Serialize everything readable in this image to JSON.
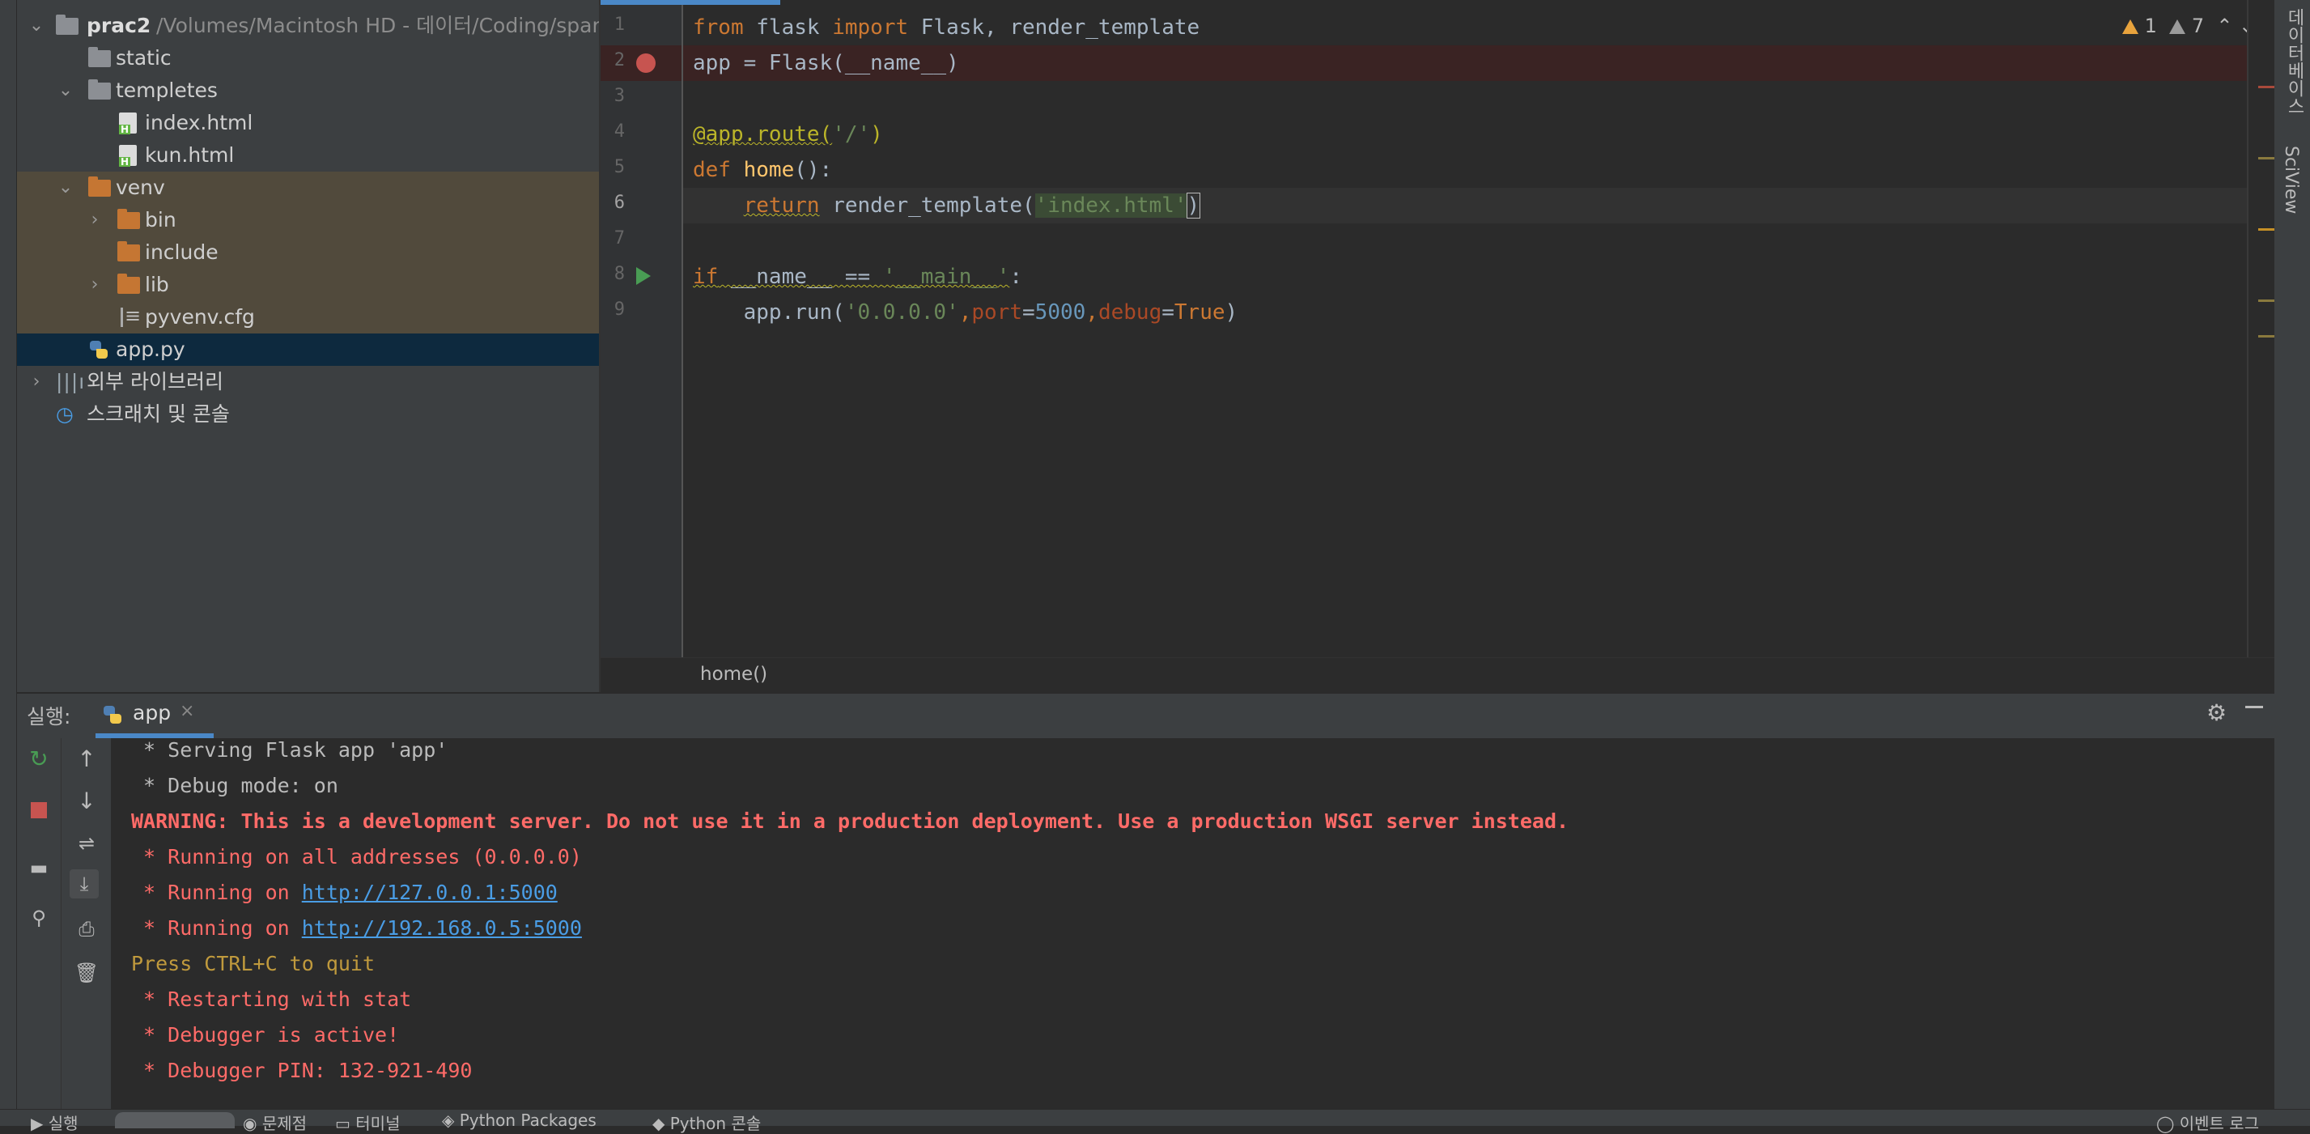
{
  "project": {
    "root": {
      "name": "prac2",
      "path": "/Volumes/Macintosh HD - 데이터/Coding/spar"
    },
    "items": [
      {
        "label": "static"
      },
      {
        "label": "templetes"
      },
      {
        "label": "index.html"
      },
      {
        "label": "kun.html"
      },
      {
        "label": "venv"
      },
      {
        "label": "bin"
      },
      {
        "label": "include"
      },
      {
        "label": "lib"
      },
      {
        "label": "pyvenv.cfg"
      },
      {
        "label": "app.py"
      },
      {
        "label": "외부 라이브러리"
      },
      {
        "label": "스크래치 및 콘솔"
      }
    ]
  },
  "editor": {
    "line_numbers": [
      "1",
      "2",
      "3",
      "4",
      "5",
      "6",
      "7",
      "8",
      "9"
    ],
    "lines": [
      [
        "from",
        " flask ",
        "import",
        " Flask, render_template"
      ],
      [
        "app = Flask(__name__)"
      ],
      [
        ""
      ],
      [
        "@app.route(",
        "'/'",
        ")"
      ],
      [
        "def",
        " ",
        "home",
        "():"
      ],
      [
        "    ",
        "return",
        " render_template(",
        "'index.html'",
        ")"
      ],
      [
        ""
      ],
      [
        "if",
        " __name__ == ",
        "'__main__'",
        ":"
      ],
      [
        "    app.run(",
        "'0.0.0.0'",
        ",",
        "port",
        "=",
        "5000",
        ",",
        "debug",
        "=",
        "True",
        ")"
      ]
    ],
    "inspections": {
      "errors": "1",
      "warnings": "7"
    },
    "breadcrumb": "home()"
  },
  "run_panel": {
    "label": "실행:",
    "tab": "app",
    "console": [
      " * Serving Flask app 'app'",
      " * Debug mode: on",
      "WARNING: This is a development server. Do not use it in a production deployment. Use a production WSGI server instead.",
      " * Running on all addresses (0.0.0.0)",
      " * Running on ",
      "http://127.0.0.1:5000",
      " * Running on ",
      "http://192.168.0.5:5000",
      "Press CTRL+C to quit",
      " * Restarting with stat",
      " * Debugger is active!",
      " * Debugger PIN: 132-921-490"
    ]
  },
  "right_strip": {
    "database": "데이터베이스",
    "sciview": "SciView"
  },
  "bottom_bar": {
    "run": "실행",
    "problems": "문제점",
    "terminal": "터미널",
    "packages": "Python Packages",
    "console": "Python 콘솔",
    "event_log": "이벤트 로그"
  },
  "colors": {
    "keyword": "#cc7832",
    "string": "#6a8759",
    "number": "#6897bb",
    "error": "#ff6b68",
    "accent": "#4a88c7"
  }
}
